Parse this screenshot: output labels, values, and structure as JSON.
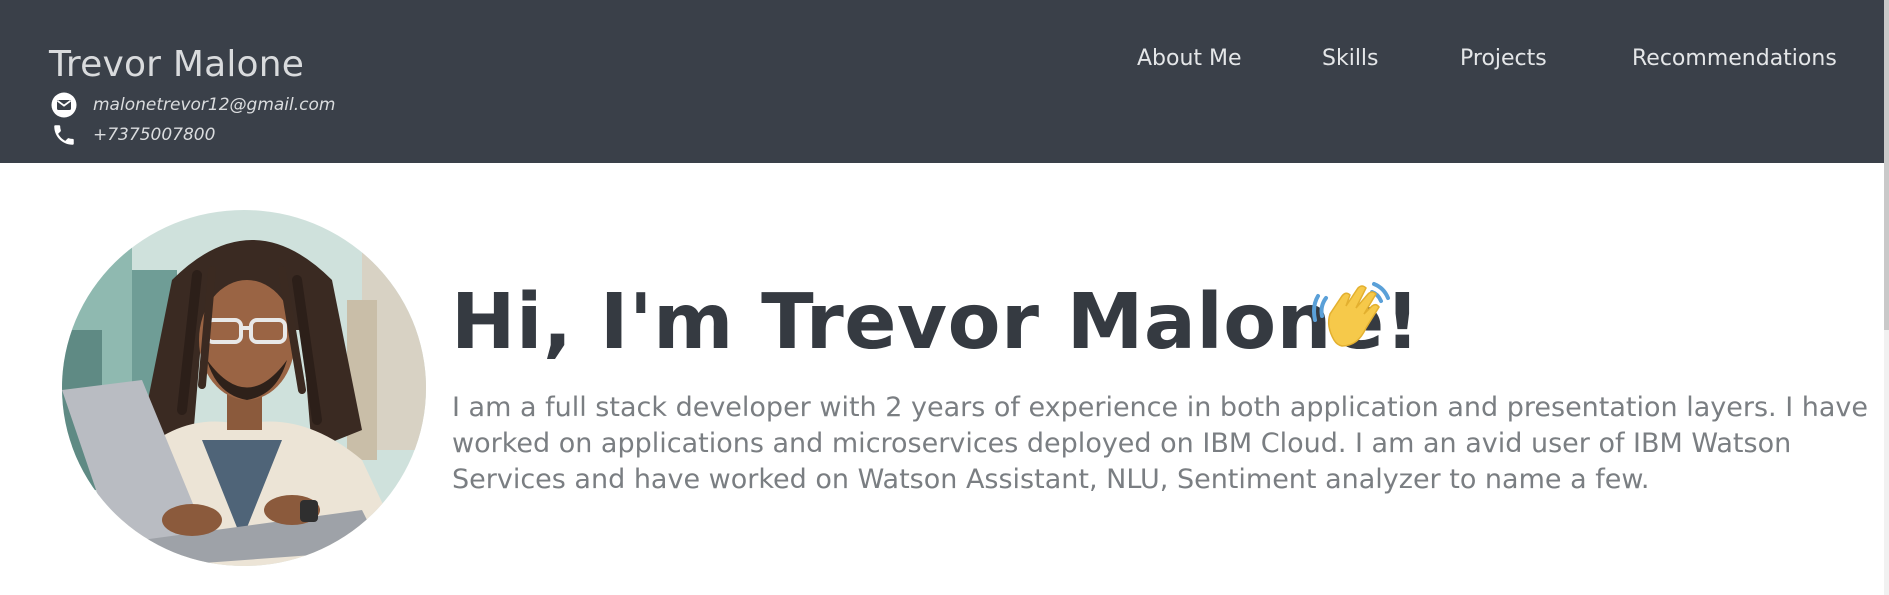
{
  "header": {
    "name": "Trevor Malone",
    "email": "malonetrevor12@gmail.com",
    "phone": "+7375007800",
    "nav": [
      "About Me",
      "Skills",
      "Projects",
      "Recommendations"
    ]
  },
  "hero": {
    "title": "Hi, I'm Trevor Malone!",
    "bio": "I am a full stack developer with 2 years of experience in both application and presentation layers. I have worked on applications and microservices deployed on IBM Cloud. I am an avid user of IBM Watson Services and have worked on Watson Assistant, NLU, Sentiment analyzer to name a few."
  },
  "icons": {
    "email": "envelope-icon",
    "phone": "phone-icon",
    "wave": "waving-hand-icon"
  },
  "colors": {
    "header_bg": "#3a4049",
    "title": "#353a41",
    "bio": "#7a7e82",
    "wave_hand": "#f6c94a"
  }
}
